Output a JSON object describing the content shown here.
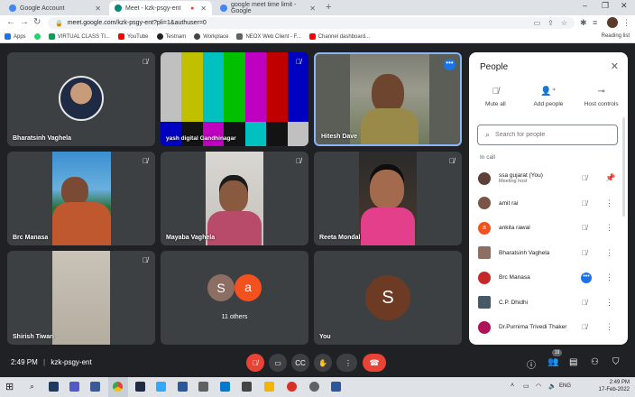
{
  "browser": {
    "tabs": [
      {
        "title": "Google Account",
        "color": "#4285f4",
        "active": false
      },
      {
        "title": "Meet - kzk-psgy-ent",
        "color": "#00897b",
        "active": true
      },
      {
        "title": "google meet time limit - Google",
        "color": "#4285f4",
        "active": false
      }
    ],
    "url": "meet.google.com/kzk-psgy-ent?pli=1&authuser=0",
    "bookmarks": [
      {
        "label": "Apps",
        "color": "#1a73e8"
      },
      {
        "label": "",
        "color": "#25d366"
      },
      {
        "label": "VIRTUAL CLASS TI...",
        "color": "#0f9d58"
      },
      {
        "label": "YouTube",
        "color": "#ff0000"
      },
      {
        "label": "Testnam",
        "color": "#202124"
      },
      {
        "label": "Workplace",
        "color": "#444444"
      },
      {
        "label": "NEOX Web Client - F...",
        "color": "#5f6368"
      },
      {
        "label": "Channel dashboard...",
        "color": "#ff0000"
      }
    ],
    "reading_list": "Reading list"
  },
  "tiles": [
    {
      "name": "Bharatsinh Vaghela"
    },
    {
      "name": "yash digital Gandhinagar"
    },
    {
      "name": "Hitesh Dave"
    },
    {
      "name": "Brc Manasa"
    },
    {
      "name": "Mayaba Vaghela"
    },
    {
      "name": "Reeta Mondal"
    },
    {
      "name": "Shirish Tiwari"
    },
    {
      "name": "11 others",
      "avatars": [
        "S",
        "a"
      ]
    },
    {
      "name": "You",
      "avatar": "S"
    }
  ],
  "people_panel": {
    "title": "People",
    "actions": [
      "Mute all",
      "Add people",
      "Host controls"
    ],
    "search_placeholder": "Search for people",
    "section": "In call",
    "people": [
      {
        "name": "ssa gujarat (You)",
        "sub": "Meeting host",
        "avatar_color": "#5d4037",
        "letter": ""
      },
      {
        "name": "amit rai",
        "sub": "",
        "avatar_color": "#795548",
        "letter": ""
      },
      {
        "name": "ankita rawal",
        "sub": "",
        "avatar_color": "#f4511e",
        "letter": "a"
      },
      {
        "name": "Bharatsinh Vaghela",
        "sub": "",
        "avatar_color": "#8d6e63",
        "letter": ""
      },
      {
        "name": "Brc Manasa",
        "sub": "",
        "avatar_color": "#c62828",
        "letter": ""
      },
      {
        "name": "C.P. Dhidhi",
        "sub": "",
        "avatar_color": "#455a64",
        "letter": ""
      },
      {
        "name": "Dr.Purnima Trivedi Thaker",
        "sub": "",
        "avatar_color": "#ad1457",
        "letter": ""
      }
    ]
  },
  "controls": {
    "time": "2:49 PM",
    "separator": "|",
    "meeting_code": "kzk-psgy-ent",
    "participant_count": "19"
  },
  "taskbar": {
    "time": "2:49 PM",
    "date": "17-Feb-2022",
    "lang": "ENG"
  }
}
